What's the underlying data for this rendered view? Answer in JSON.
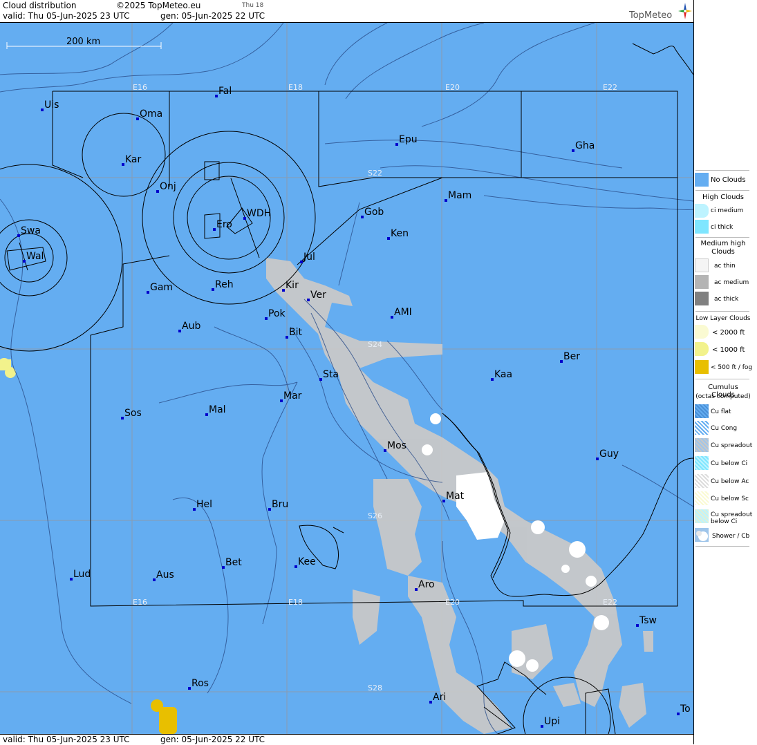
{
  "header": {
    "title": "Cloud distribution",
    "copyright": "©2025 TopMeteo.eu",
    "day_label": "Thu 18",
    "valid": "valid:  Thu  05-Jun-2025  23 UTC",
    "gen": "gen: 05-Jun-2025 22 UTC",
    "logo": "TopMeteo"
  },
  "footer": {
    "valid": "valid:  Thu  05-Jun-2025  23 UTC",
    "gen": "gen: 05-Jun-2025 22 UTC"
  },
  "scale_bar": {
    "label": "200 km"
  },
  "grid_labels": {
    "lon": [
      "E16",
      "E18",
      "E20",
      "E22"
    ],
    "lat": [
      "S22",
      "S24",
      "S26",
      "S28"
    ]
  },
  "places": [
    {
      "name": "Uis"
    },
    {
      "name": "Fal"
    },
    {
      "name": "Oma"
    },
    {
      "name": "Kar"
    },
    {
      "name": "Epu"
    },
    {
      "name": "Gha"
    },
    {
      "name": "Onj"
    },
    {
      "name": "Mam"
    },
    {
      "name": "Swa"
    },
    {
      "name": "WDH"
    },
    {
      "name": "Gob"
    },
    {
      "name": "Ero"
    },
    {
      "name": "Ken"
    },
    {
      "name": "Wal"
    },
    {
      "name": "Jul"
    },
    {
      "name": "Gam"
    },
    {
      "name": "Reh"
    },
    {
      "name": "Kir"
    },
    {
      "name": "Ver"
    },
    {
      "name": "AMI"
    },
    {
      "name": "Pok"
    },
    {
      "name": "Aub"
    },
    {
      "name": "Bit"
    },
    {
      "name": "Ber"
    },
    {
      "name": "Sta"
    },
    {
      "name": "Kaa"
    },
    {
      "name": "Mar"
    },
    {
      "name": "Sos"
    },
    {
      "name": "Mal"
    },
    {
      "name": "Mos"
    },
    {
      "name": "Guy"
    },
    {
      "name": "Mat"
    },
    {
      "name": "Hel"
    },
    {
      "name": "Bru"
    },
    {
      "name": "Bet"
    },
    {
      "name": "Kee"
    },
    {
      "name": "Lud"
    },
    {
      "name": "Aus"
    },
    {
      "name": "Aro"
    },
    {
      "name": "Tsw"
    },
    {
      "name": "Ros"
    },
    {
      "name": "Ari"
    },
    {
      "name": "To"
    },
    {
      "name": "Upi"
    }
  ],
  "legend": {
    "no_clouds": "No Clouds",
    "high_head": "High Clouds",
    "ci_medium": "ci medium",
    "ci_thick": "ci thick",
    "medium_head": "Medium high Clouds",
    "ac_thin": "ac thin",
    "ac_medium": "ac medium",
    "ac_thick": "ac thick",
    "low_head": "Low Layer Clouds",
    "low_2000": "< 2000 ft",
    "low_1000": "< 1000 ft",
    "low_500": "< 500 ft / fog",
    "cu_head": "Cumulus Clouds",
    "cu_sub": "(octas computed)",
    "cu_flat": "Cu flat",
    "cu_cong": "Cu Cong",
    "cu_spreadout": "Cu spreadout",
    "cu_below_ci": "Cu below Ci",
    "cu_below_ac": "Cu below Ac",
    "cu_below_sc": "Cu below Sc",
    "cu_spreadout_below_ci": "Cu spreadout below Ci",
    "shower": "Shower / Cb"
  },
  "colors": {
    "no_clouds": "#64adf1",
    "cumulus": "#c8c8c8",
    "shower": "#ffffff",
    "low_1000": "#f2f28c",
    "fog": "#e8bf00",
    "place_marker": "#0000cc"
  }
}
